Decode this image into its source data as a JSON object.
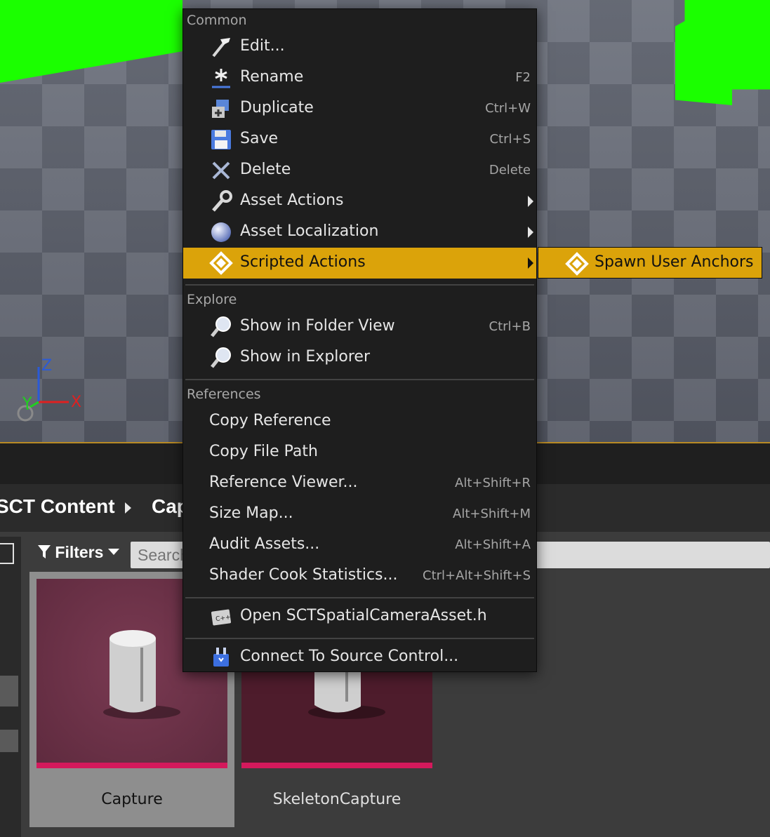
{
  "viewport": {
    "axis": {
      "z": "Z",
      "y": "Y",
      "x": "X"
    },
    "colors": {
      "highlight_geometry": "#1bff00",
      "axis_x": "#e02020",
      "axis_y": "#20d020",
      "axis_z": "#2a5ad8"
    }
  },
  "breadcrumb": {
    "items": [
      "SCT Content",
      "Cap"
    ]
  },
  "toolbar": {
    "filters_label": "Filters",
    "search_placeholder": "Search"
  },
  "assets": [
    {
      "name": "Capture",
      "color": "#d4195c"
    },
    {
      "name": "SkeletonCapture",
      "color": "#d4195c"
    }
  ],
  "menu": {
    "sections": {
      "common": "Common",
      "explore": "Explore",
      "references": "References"
    },
    "common": [
      {
        "label": "Edit...",
        "shortcut": "",
        "icon": "hammer-icon"
      },
      {
        "label": "Rename",
        "shortcut": "F2",
        "icon": "rename-asterisk-icon"
      },
      {
        "label": "Duplicate",
        "shortcut": "Ctrl+W",
        "icon": "duplicate-icon"
      },
      {
        "label": "Save",
        "shortcut": "Ctrl+S",
        "icon": "floppy-disk-icon"
      },
      {
        "label": "Delete",
        "shortcut": "Delete",
        "icon": "delete-x-icon"
      },
      {
        "label": "Asset Actions",
        "shortcut": "",
        "icon": "wrench-icon",
        "submenu": true
      },
      {
        "label": "Asset Localization",
        "shortcut": "",
        "icon": "globe-icon",
        "submenu": true
      },
      {
        "label": "Scripted Actions",
        "shortcut": "",
        "icon": "scripted-action-icon",
        "submenu": true,
        "highlighted": true
      }
    ],
    "explore": [
      {
        "label": "Show in Folder View",
        "shortcut": "Ctrl+B",
        "icon": "magnifier-icon"
      },
      {
        "label": "Show in Explorer",
        "shortcut": "",
        "icon": "magnifier-icon"
      }
    ],
    "references": [
      {
        "label": "Copy Reference",
        "shortcut": ""
      },
      {
        "label": "Copy File Path",
        "shortcut": ""
      },
      {
        "label": "Reference Viewer...",
        "shortcut": "Alt+Shift+R"
      },
      {
        "label": "Size Map...",
        "shortcut": "Alt+Shift+M"
      },
      {
        "label": "Audit Assets...",
        "shortcut": "Alt+Shift+A"
      },
      {
        "label": "Shader Cook Statistics...",
        "shortcut": "Ctrl+Alt+Shift+S"
      }
    ],
    "source": {
      "label": "Open SCTSpatialCameraAsset.h",
      "icon": "cpp-file-icon"
    },
    "source_control": {
      "label": "Connect To Source Control...",
      "icon": "source-control-icon"
    },
    "highlight_color": "#dba30a"
  },
  "submenu": {
    "items": [
      {
        "label": "Spawn User Anchors",
        "icon": "scripted-action-icon"
      }
    ]
  }
}
